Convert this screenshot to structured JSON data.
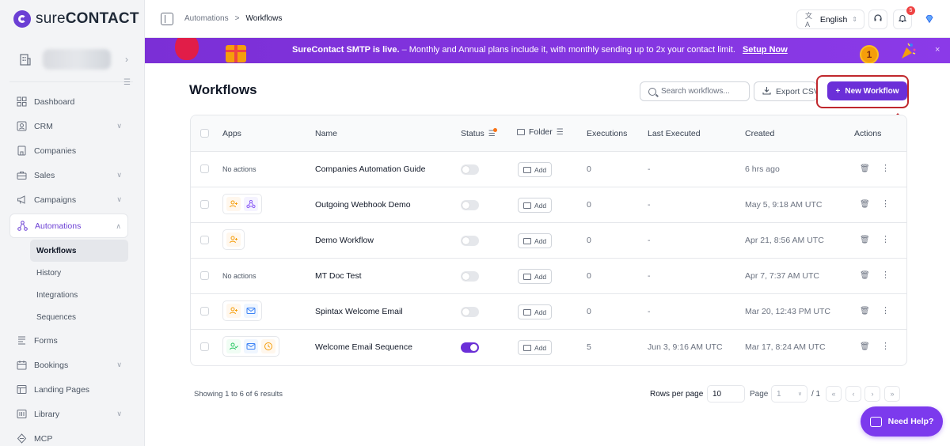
{
  "brand": {
    "name_light": "sure",
    "name_bold": "CONTACT"
  },
  "sidebar": {
    "items": [
      {
        "label": "Dashboard",
        "icon": "dashboard-icon",
        "expandable": false
      },
      {
        "label": "CRM",
        "icon": "crm-icon",
        "expandable": true
      },
      {
        "label": "Companies",
        "icon": "building-icon",
        "expandable": false
      },
      {
        "label": "Sales",
        "icon": "briefcase-icon",
        "expandable": true
      },
      {
        "label": "Campaigns",
        "icon": "megaphone-icon",
        "expandable": true
      },
      {
        "label": "Automations",
        "icon": "automation-icon",
        "expandable": true,
        "active": true
      },
      {
        "label": "Forms",
        "icon": "form-icon",
        "expandable": false
      },
      {
        "label": "Bookings",
        "icon": "calendar-icon",
        "expandable": true
      },
      {
        "label": "Landing Pages",
        "icon": "layout-icon",
        "expandable": false
      },
      {
        "label": "Library",
        "icon": "library-icon",
        "expandable": true
      },
      {
        "label": "MCP",
        "icon": "mcp-icon",
        "expandable": false
      }
    ],
    "subitems": [
      {
        "label": "Workflows",
        "active": true
      },
      {
        "label": "History"
      },
      {
        "label": "Integrations"
      },
      {
        "label": "Sequences"
      }
    ]
  },
  "breadcrumb": {
    "parent": "Automations",
    "separator": ">",
    "current": "Workflows"
  },
  "header": {
    "language": "English",
    "notification_count": "5"
  },
  "banner": {
    "headline": "SureContact SMTP is live.",
    "dash": "–",
    "message": "Monthly and Annual plans include it, with monthly sending up to 2x your contact limit.",
    "link": "Setup Now",
    "medal": "1",
    "close": "×"
  },
  "page": {
    "title": "Workflows",
    "search_placeholder": "Search workflows...",
    "export_label": "Export CSV",
    "new_label": "New Workflow"
  },
  "table": {
    "columns": {
      "apps": "Apps",
      "name": "Name",
      "status": "Status",
      "folder": "Folder",
      "executions": "Executions",
      "last_executed": "Last Executed",
      "created": "Created",
      "actions": "Actions"
    },
    "add_label": "Add",
    "no_actions_label": "No actions",
    "rows": [
      {
        "apps": [],
        "name": "Companies Automation Guide",
        "status": false,
        "executions": "0",
        "last_executed": "-",
        "created": "6 hrs ago"
      },
      {
        "apps": [
          "user-plus-icon",
          "webhook-icon"
        ],
        "name": "Outgoing Webhook Demo",
        "status": false,
        "executions": "0",
        "last_executed": "-",
        "created": "May 5, 9:18 AM UTC"
      },
      {
        "apps": [
          "user-plus-icon"
        ],
        "name": "Demo Workflow",
        "status": false,
        "executions": "0",
        "last_executed": "-",
        "created": "Apr 21, 8:56 AM UTC"
      },
      {
        "apps": [],
        "name": "MT Doc Test",
        "status": false,
        "executions": "0",
        "last_executed": "-",
        "created": "Apr 7, 7:37 AM UTC"
      },
      {
        "apps": [
          "user-plus-icon",
          "mail-icon"
        ],
        "name": "Spintax Welcome Email",
        "status": false,
        "executions": "0",
        "last_executed": "-",
        "created": "Mar 20, 12:43 PM UTC"
      },
      {
        "apps": [
          "user-check-icon",
          "mail-icon",
          "clock-icon"
        ],
        "name": "Welcome Email Sequence",
        "status": true,
        "executions": "5",
        "last_executed": "Jun 3, 9:16 AM UTC",
        "created": "Mar 17, 8:24 AM UTC"
      }
    ]
  },
  "footer": {
    "showing": "Showing 1 to 6 of 6 results",
    "rows_per_page_label": "Rows per page",
    "rows_per_page": "10",
    "page_label": "Page",
    "current_page": "1",
    "total_pages": "/ 1"
  },
  "help": {
    "label": "Need Help?"
  },
  "colors": {
    "accent": "#6b2fd8",
    "banner": "#7b2fd6",
    "highlight": "#c0282d"
  }
}
